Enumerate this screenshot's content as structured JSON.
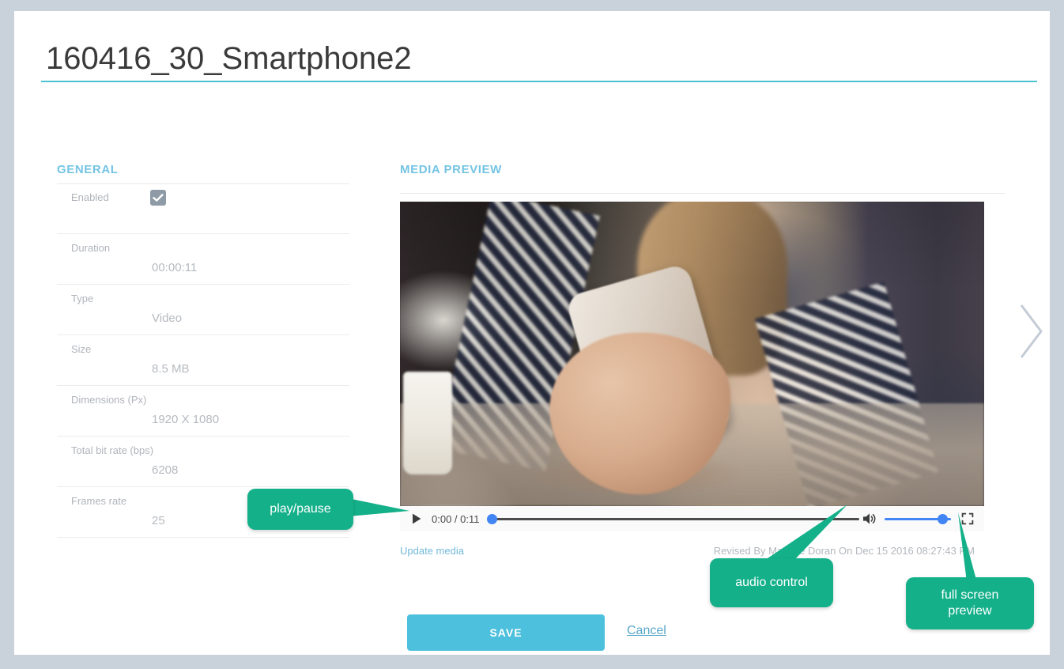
{
  "page": {
    "title": "160416_30_Smartphone2",
    "accent_teal": "#4ec3d0",
    "accent_blue": "#74c4e3",
    "callout_green": "#14b08a",
    "save_blue": "#4dc0dd",
    "background": "#c9d2db"
  },
  "general": {
    "heading": "GENERAL",
    "fields": [
      {
        "label": "Enabled",
        "value": "",
        "type": "checkbox",
        "checked": true
      },
      {
        "label": "Duration",
        "value": "00:00:11",
        "type": "text"
      },
      {
        "label": "Type",
        "value": "Video",
        "type": "text"
      },
      {
        "label": "Size",
        "value": "8.5 MB",
        "type": "text"
      },
      {
        "label": "Dimensions (Px)",
        "value": "1920 X 1080",
        "type": "text"
      },
      {
        "label": "Total bit rate (bps)",
        "value": "6208",
        "type": "text"
      },
      {
        "label": "Frames rate",
        "value": "25",
        "type": "text"
      }
    ]
  },
  "media": {
    "heading": "MEDIA PREVIEW",
    "player": {
      "play_icon": "play-icon",
      "time_display": "0:00 / 0:11",
      "current_time": "0:00",
      "total_time": "0:11",
      "progress_percent": 0,
      "volume_icon": "speaker-icon",
      "volume_percent": 92,
      "fullscreen_icon": "fullscreen-icon",
      "scrubber_color": "#4285f4"
    },
    "update_link": "Update media",
    "revised_text": "Revised By Maurice Doran On Dec 15 2016 08:27:43 PM"
  },
  "actions": {
    "save_label": "SAVE",
    "cancel_label": "Cancel"
  },
  "navigation": {
    "next_icon": "chevron-right-icon"
  },
  "callouts": [
    {
      "id": "play",
      "text": "play/pause"
    },
    {
      "id": "audio",
      "text": "audio control"
    },
    {
      "id": "fullscreen",
      "text": "full screen\npreview"
    }
  ]
}
